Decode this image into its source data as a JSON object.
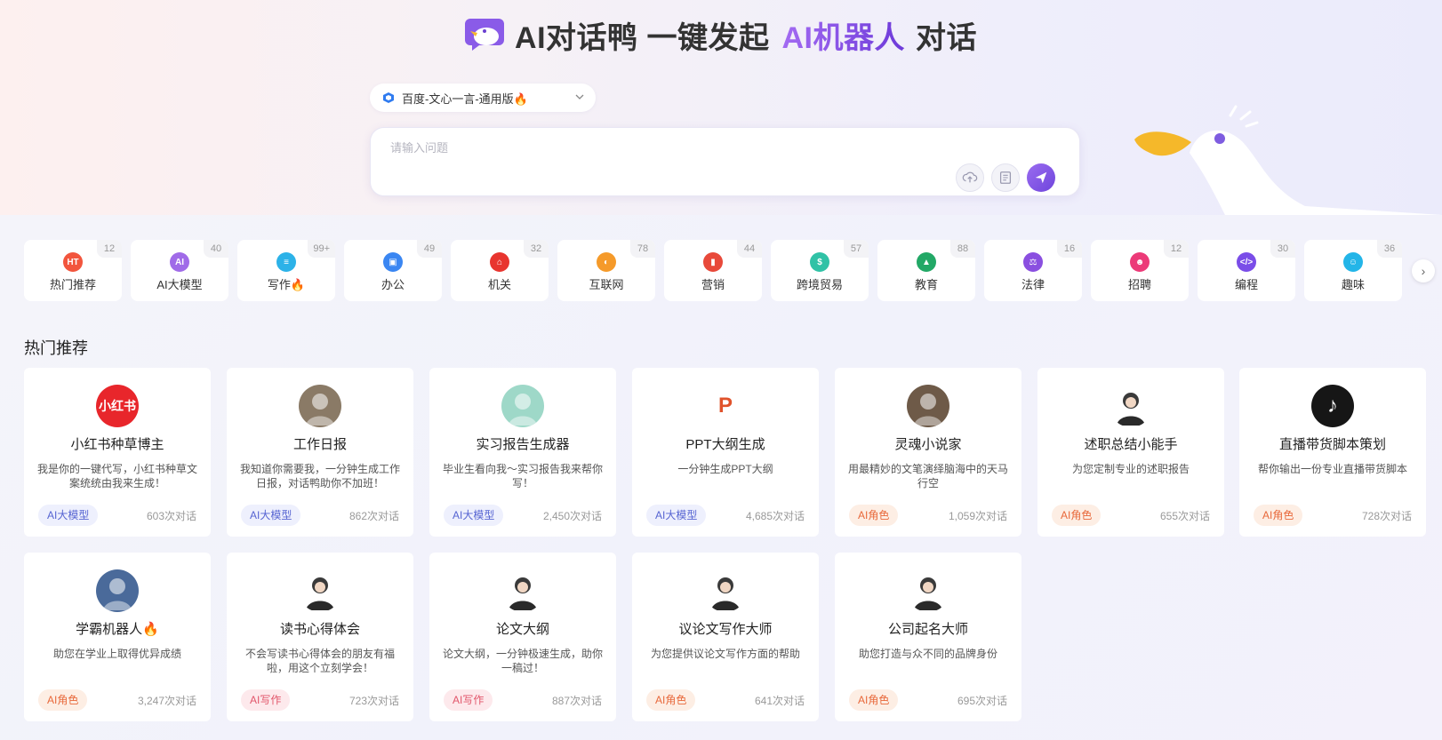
{
  "header": {
    "title_part1": "AI对话鸭 一键发起",
    "title_part2": "AI机器人",
    "title_part3": "对话"
  },
  "model_select": {
    "label": "百度-文心一言-通用版🔥"
  },
  "ask": {
    "placeholder": "请输入问题"
  },
  "categories": [
    {
      "label": "热门推荐",
      "count": "12",
      "icon": "fire-icon",
      "color": "#f2553d",
      "glyph": "HT"
    },
    {
      "label": "AI大模型",
      "count": "40",
      "icon": "ai-chip-icon",
      "color": "#a06be8",
      "glyph": "AI"
    },
    {
      "label": "写作🔥",
      "count": "99+",
      "icon": "document-icon",
      "color": "#2cb2e8",
      "glyph": "≡"
    },
    {
      "label": "办公",
      "count": "49",
      "icon": "briefcase-icon",
      "color": "#3a86f2",
      "glyph": "▣"
    },
    {
      "label": "机关",
      "count": "32",
      "icon": "building-icon",
      "color": "#e8352f",
      "glyph": "⌂"
    },
    {
      "label": "互联网",
      "count": "78",
      "icon": "planet-icon",
      "color": "#f59a2a",
      "glyph": "◐"
    },
    {
      "label": "营销",
      "count": "44",
      "icon": "chart-icon",
      "color": "#e8493a",
      "glyph": "▮"
    },
    {
      "label": "跨境贸易",
      "count": "57",
      "icon": "trade-icon",
      "color": "#30c2a6",
      "glyph": "$"
    },
    {
      "label": "教育",
      "count": "88",
      "icon": "graduation-cap-icon",
      "color": "#22a866",
      "glyph": "▲"
    },
    {
      "label": "法律",
      "count": "16",
      "icon": "gavel-icon",
      "color": "#8a4fe0",
      "glyph": "⚖"
    },
    {
      "label": "招聘",
      "count": "12",
      "icon": "recruit-icon",
      "color": "#ec3a78",
      "glyph": "☻"
    },
    {
      "label": "编程",
      "count": "30",
      "icon": "code-icon",
      "color": "#7a4de8",
      "glyph": "</>"
    },
    {
      "label": "趣味",
      "count": "36",
      "icon": "smile-icon",
      "color": "#23b5e8",
      "glyph": "☺"
    }
  ],
  "section": {
    "title": "热门推荐"
  },
  "cards": [
    {
      "title": "小红书种草博主",
      "desc": "我是你的一键代写，小红书种草文案统统由我来生成！",
      "tag": "AI大模型",
      "tag_type": "model",
      "count": "603次对话",
      "avatar_text": "小红书",
      "avatar_color": "#e8262b"
    },
    {
      "title": "工作日报",
      "desc": "我知道你需要我，一分钟生成工作日报，对话鸭助你不加班！",
      "tag": "AI大模型",
      "tag_type": "model",
      "count": "862次对话",
      "avatar_text": "",
      "avatar_color": "#8a7a66"
    },
    {
      "title": "实习报告生成器",
      "desc": "毕业生看向我～实习报告我来帮你写！",
      "tag": "AI大模型",
      "tag_type": "model",
      "count": "2,450次对话",
      "avatar_text": "",
      "avatar_color": "#9ed8c8"
    },
    {
      "title": "PPT大纲生成",
      "desc": "一分钟生成PPT大纲",
      "tag": "AI大模型",
      "tag_type": "model",
      "count": "4,685次对话",
      "avatar_text": "P",
      "avatar_color": "#ffffff"
    },
    {
      "title": "灵魂小说家",
      "desc": "用最精妙的文笔演绎脑海中的天马行空",
      "tag": "AI角色",
      "tag_type": "role",
      "count": "1,059次对话",
      "avatar_text": "",
      "avatar_color": "#6e5a48"
    },
    {
      "title": "述职总结小能手",
      "desc": "为您定制专业的述职报告",
      "tag": "AI角色",
      "tag_type": "role",
      "count": "655次对话",
      "avatar_text": "",
      "avatar_color": "#ffffff"
    },
    {
      "title": "直播带货脚本策划",
      "desc": "帮你输出一份专业直播带货脚本",
      "tag": "AI角色",
      "tag_type": "role",
      "count": "728次对话",
      "avatar_text": "♪",
      "avatar_color": "#161616"
    },
    {
      "title": "学霸机器人🔥",
      "desc": "助您在学业上取得优异成绩",
      "tag": "AI角色",
      "tag_type": "role",
      "count": "3,247次对话",
      "avatar_text": "",
      "avatar_color": "#4a6a9a"
    },
    {
      "title": "读书心得体会",
      "desc": "不会写读书心得体会的朋友有福啦，用这个立刻学会！",
      "tag": "AI写作",
      "tag_type": "write",
      "count": "723次对话",
      "avatar_text": "",
      "avatar_color": "#ffffff"
    },
    {
      "title": "论文大纲",
      "desc": "论文大纲，一分钟极速生成，助你一稿过！",
      "tag": "AI写作",
      "tag_type": "write",
      "count": "887次对话",
      "avatar_text": "",
      "avatar_color": "#ffffff"
    },
    {
      "title": "议论文写作大师",
      "desc": "为您提供议论文写作方面的帮助",
      "tag": "AI角色",
      "tag_type": "role",
      "count": "641次对话",
      "avatar_text": "",
      "avatar_color": "#ffffff"
    },
    {
      "title": "公司起名大师",
      "desc": "助您打造与众不同的品牌身份",
      "tag": "AI角色",
      "tag_type": "role",
      "count": "695次对话",
      "avatar_text": "",
      "avatar_color": "#ffffff"
    }
  ],
  "colors": {
    "accent": "#7b4fe0",
    "tag_model": "#5664d2",
    "tag_role": "#e8683a",
    "tag_write": "#e2566b"
  }
}
